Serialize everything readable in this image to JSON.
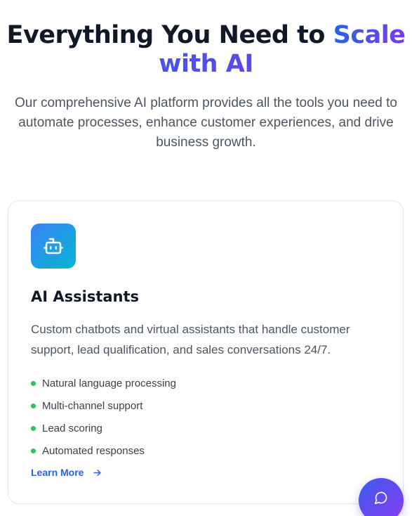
{
  "hero": {
    "title_prefix": "Everything You Need to",
    "title_highlight_1": "Scale",
    "title_highlight_2": "with AI",
    "subtitle": "Our comprehensive AI platform provides all the tools you need to automate processes, enhance customer experiences, and drive business growth."
  },
  "card": {
    "icon": "bot-icon",
    "title": "AI Assistants",
    "description": "Custom chatbots and virtual assistants that handle customer support, lead qualification, and sales conversations 24/7.",
    "features": [
      "Natural language processing",
      "Multi-channel support",
      "Lead scoring",
      "Automated responses"
    ],
    "link_label": "Learn More",
    "link_icon": "arrow-right-icon"
  },
  "chat_widget": {
    "icon": "chat-bubble-icon"
  },
  "colors": {
    "heading": "#111827",
    "body_text": "#4b5563",
    "gradient_start": "#2563eb",
    "gradient_end": "#7c3aed",
    "icon_gradient_start": "#3b82f6",
    "icon_gradient_end": "#06b6d4",
    "feature_dot": "#22c55e",
    "link": "#2563eb"
  }
}
